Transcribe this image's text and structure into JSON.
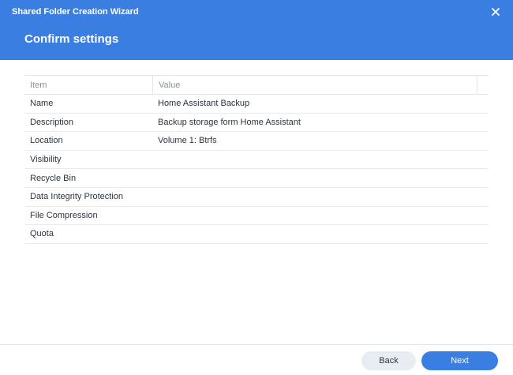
{
  "window": {
    "title": "Shared Folder Creation Wizard",
    "step_title": "Confirm settings",
    "close_icon": "close-icon"
  },
  "colors": {
    "header": "#3a7ee2",
    "primary_button": "#3a7ee2",
    "secondary_button": "#e8edf3"
  },
  "grid": {
    "columns": [
      "Item",
      "Value"
    ],
    "rows": [
      {
        "item": "Name",
        "value": "Home Assistant Backup"
      },
      {
        "item": "Description",
        "value": "Backup storage form Home Assistant"
      },
      {
        "item": "Location",
        "value": "Volume 1: Btrfs"
      },
      {
        "item": "Visibility",
        "value": ""
      },
      {
        "item": "Recycle Bin",
        "value": ""
      },
      {
        "item": "Data Integrity Protection",
        "value": ""
      },
      {
        "item": "File Compression",
        "value": ""
      },
      {
        "item": "Quota",
        "value": ""
      }
    ]
  },
  "footer": {
    "back_label": "Back",
    "next_label": "Next"
  }
}
